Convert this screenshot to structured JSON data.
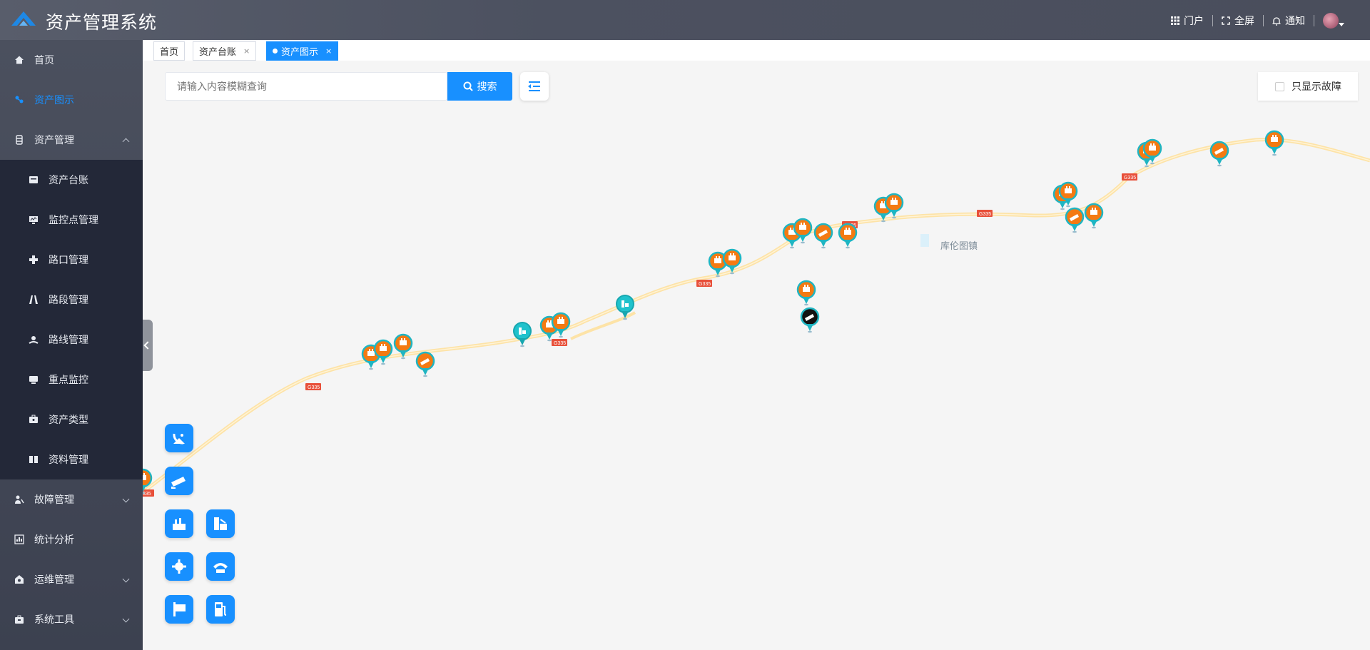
{
  "header": {
    "title": "资产管理系统",
    "links": [
      {
        "label": "门户",
        "icon": "grid-icon"
      },
      {
        "label": "全屏",
        "icon": "fullscreen-icon"
      },
      {
        "label": "通知",
        "icon": "bell-icon"
      }
    ]
  },
  "sidebar": {
    "items": [
      {
        "label": "首页",
        "icon": "home-icon"
      },
      {
        "label": "资产图示",
        "icon": "map-marker-icon",
        "active": true
      },
      {
        "label": "资产管理",
        "icon": "asset-icon",
        "expanded": true
      },
      {
        "label": "故障管理",
        "icon": "fault-icon"
      },
      {
        "label": "统计分析",
        "icon": "chart-icon"
      },
      {
        "label": "运维管理",
        "icon": "ops-icon"
      },
      {
        "label": "系统工具",
        "icon": "toolbox-icon"
      }
    ],
    "submenu": [
      {
        "label": "资产台账",
        "icon": "ledger-icon"
      },
      {
        "label": "监控点管理",
        "icon": "monitor-icon"
      },
      {
        "label": "路口管理",
        "icon": "crossroad-icon"
      },
      {
        "label": "路段管理",
        "icon": "road-icon"
      },
      {
        "label": "路线管理",
        "icon": "route-icon"
      },
      {
        "label": "重点监控",
        "icon": "screen-icon"
      },
      {
        "label": "资产类型",
        "icon": "type-icon"
      },
      {
        "label": "资料管理",
        "icon": "book-icon"
      }
    ]
  },
  "tabs": [
    {
      "label": "首页"
    },
    {
      "label": "资产台账",
      "close": "×"
    },
    {
      "label": "资产图示",
      "close": "×",
      "active": true
    }
  ],
  "search": {
    "placeholder": "请输入内容模糊查询",
    "button": "搜索"
  },
  "fault_filter": {
    "label": "只显示故障"
  },
  "map": {
    "road_label": "G335",
    "town": "库伦图镇"
  },
  "colors": {
    "accent": "#1890ff",
    "marker_orange": "#f47a12",
    "marker_teal": "#1fc2cc",
    "road": "#fde3a7"
  }
}
